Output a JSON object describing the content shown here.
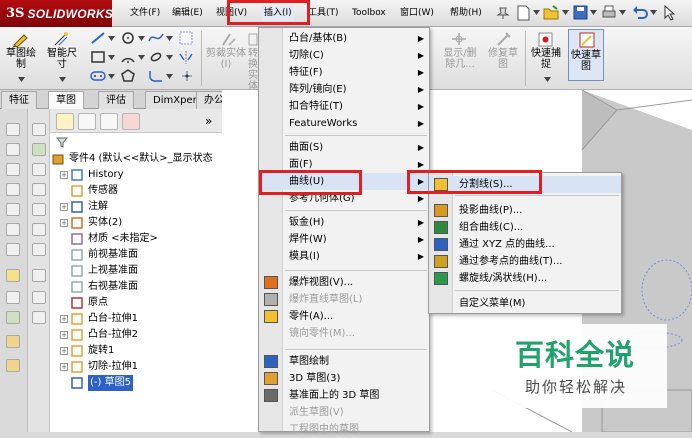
{
  "app": {
    "brand": "SOLIDWORKS",
    "ds": "3S"
  },
  "menubar": {
    "items": [
      {
        "label": "文件(F)"
      },
      {
        "label": "编辑(E)"
      },
      {
        "label": "视图(V)"
      },
      {
        "label": "插入(I)"
      },
      {
        "label": "工具(T)"
      },
      {
        "label": "Toolbox"
      },
      {
        "label": "窗口(W)"
      },
      {
        "label": "帮助(H)"
      }
    ]
  },
  "ribbon": {
    "sketch": "草图绘制",
    "smart_dim": "智能尺寸",
    "trim": "剪裁实体(I)",
    "convert": "转换实体",
    "show_delete": "显示/删除几...",
    "repair": "修复草图",
    "quick_snap": "快速捕捉",
    "rapid_sketch": "快速草图"
  },
  "tabs": [
    "特征",
    "草图",
    "评估",
    "DimXpert",
    "办公室产品"
  ],
  "tree": {
    "root": "零件4 (默认<<默认>_显示状态",
    "items": [
      {
        "label": "History",
        "expand": true
      },
      {
        "label": "传感器",
        "expand": false
      },
      {
        "label": "注解",
        "expand": true
      },
      {
        "label": "实体(2)",
        "expand": true
      },
      {
        "label": "材质 <未指定>",
        "expand": false
      },
      {
        "label": "前视基准面",
        "expand": false
      },
      {
        "label": "上视基准面",
        "expand": false
      },
      {
        "label": "右视基准面",
        "expand": false
      },
      {
        "label": "原点",
        "expand": false
      },
      {
        "label": "凸台-拉伸1",
        "expand": true
      },
      {
        "label": "凸台-拉伸2",
        "expand": true
      },
      {
        "label": "旋转1",
        "expand": true
      },
      {
        "label": "切除-拉伸1",
        "expand": true
      },
      {
        "label": "(-) 草图5",
        "expand": false
      }
    ]
  },
  "insert_menu": {
    "items": [
      {
        "label": "凸台/基体(B)",
        "submenu": true
      },
      {
        "label": "切除(C)",
        "submenu": true
      },
      {
        "label": "特征(F)",
        "submenu": true
      },
      {
        "label": "阵列/镜向(E)",
        "submenu": true
      },
      {
        "label": "扣合特征(T)",
        "submenu": true
      },
      {
        "label": "FeatureWorks",
        "submenu": true
      },
      {
        "label": "曲面(S)",
        "submenu": true
      },
      {
        "label": "面(F)",
        "submenu": true
      },
      {
        "label": "曲线(U)",
        "submenu": true
      },
      {
        "label": "参考几何体(G)",
        "submenu": true
      },
      {
        "label": "钣金(H)",
        "submenu": true
      },
      {
        "label": "焊件(W)",
        "submenu": true
      },
      {
        "label": "模具(I)",
        "submenu": true
      },
      {
        "label": "爆炸视图(V)...",
        "submenu": false
      },
      {
        "label": "爆炸直线草图(L)",
        "submenu": false
      },
      {
        "label": "零件(A)...",
        "submenu": false
      },
      {
        "label": "镜向零件(M)...",
        "submenu": false
      },
      {
        "label": "草图绘制",
        "submenu": false
      },
      {
        "label": "3D 草图(3)",
        "submenu": false
      },
      {
        "label": "基准面上的 3D 草图",
        "submenu": false
      },
      {
        "label": "派生草图(V)",
        "submenu": false
      },
      {
        "label": "工程图中的草图",
        "submenu": false
      }
    ]
  },
  "curve_menu": {
    "items": [
      {
        "label": "分割线(S)..."
      },
      {
        "label": "投影曲线(P)..."
      },
      {
        "label": "组合曲线(C)..."
      },
      {
        "label": "通过 XYZ 点的曲线..."
      },
      {
        "label": "通过参考点的曲线(T)..."
      },
      {
        "label": "螺旋线/涡状线(H)..."
      },
      {
        "label": "自定义菜单(M)"
      }
    ]
  },
  "watermark": {
    "main": "百科全说",
    "sub": "助你轻松解决"
  },
  "colors": {
    "highlight": "#e02020",
    "selected": "#2d62c9",
    "watermark": "#21a26d",
    "logo": "#b30d11"
  }
}
